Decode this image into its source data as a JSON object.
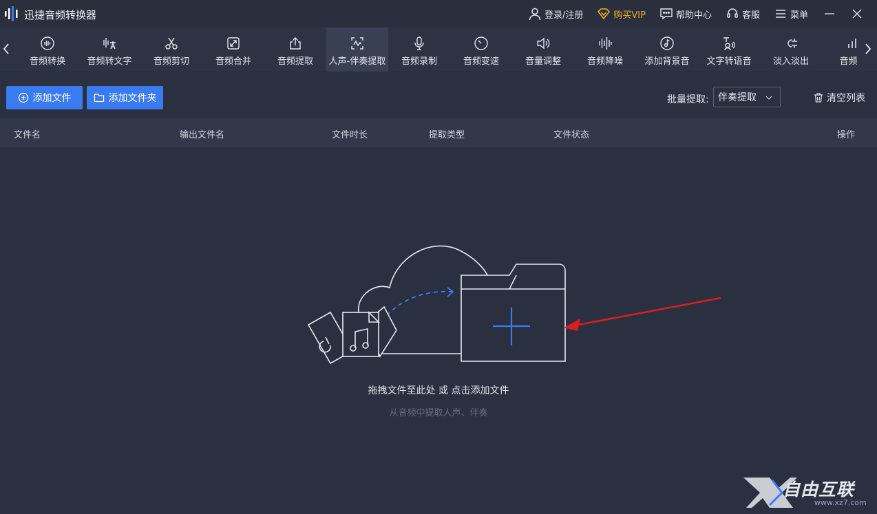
{
  "app": {
    "title": "迅捷音频转换器"
  },
  "titlebar": {
    "login": "登录/注册",
    "vip": "购买VIP",
    "help": "帮助中心",
    "service": "客服",
    "menu": "菜单"
  },
  "tools": [
    {
      "label": "音频转换",
      "icon": "waveform-circle-icon"
    },
    {
      "label": "音频转文字",
      "icon": "audio-to-text-icon"
    },
    {
      "label": "音频剪切",
      "icon": "scissors-icon"
    },
    {
      "label": "音频合并",
      "icon": "merge-icon"
    },
    {
      "label": "音频提取",
      "icon": "upload-extract-icon"
    },
    {
      "label": "人声-伴奏提取",
      "icon": "vocal-extract-icon",
      "active": true
    },
    {
      "label": "音频录制",
      "icon": "microphone-icon"
    },
    {
      "label": "音频变速",
      "icon": "speed-icon"
    },
    {
      "label": "音量调整",
      "icon": "volume-icon"
    },
    {
      "label": "音频降噪",
      "icon": "denoise-icon"
    },
    {
      "label": "添加背景音",
      "icon": "music-note-icon"
    },
    {
      "label": "文字转语音",
      "icon": "text-to-speech-icon"
    },
    {
      "label": "淡入淡出",
      "icon": "fade-icon"
    },
    {
      "label": "音频变",
      "icon": "bars-icon"
    }
  ],
  "actions": {
    "add_file": "添加文件",
    "add_folder": "添加文件夹",
    "batch_label": "批量提取:",
    "batch_value": "伴奏提取",
    "clear_list": "清空列表"
  },
  "table": {
    "headers": [
      "文件名",
      "输出文件名",
      "文件时长",
      "提取类型",
      "文件状态",
      "操作"
    ]
  },
  "empty_state": {
    "prompt_part1": "拖拽文件至此处",
    "prompt_or": " 或 ",
    "prompt_link": "点击添加文件",
    "subtitle": "从音频中提取人声、伴奏"
  },
  "watermark": {
    "text": "自由互联",
    "url": "www.xz7.com"
  },
  "colors": {
    "accent": "#3b7bf0",
    "vip": "#e9b022",
    "annotation_arrow": "#d81e1e",
    "background": "#2b3040"
  }
}
